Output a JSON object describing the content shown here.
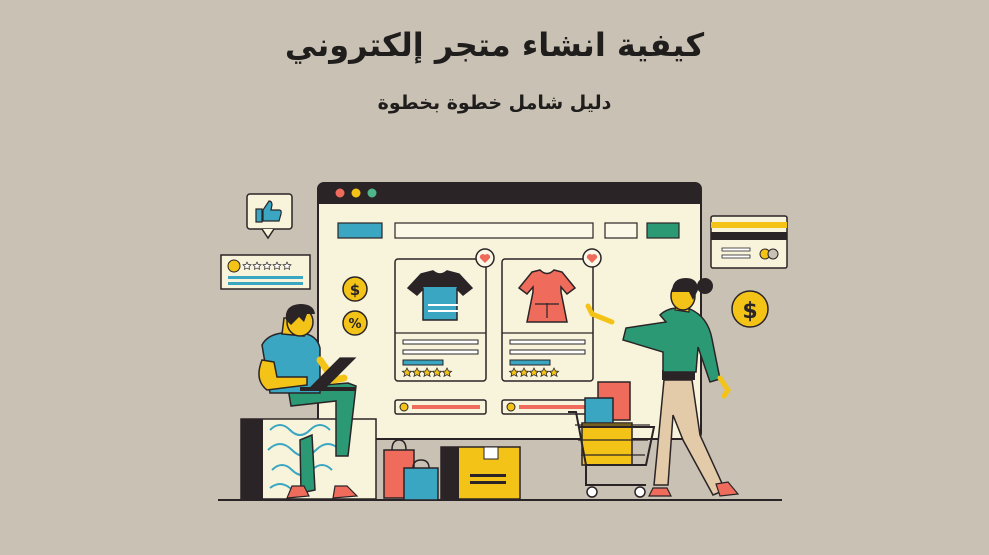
{
  "heading": {
    "title": "كيفية انشاء متجر إلكتروني",
    "subtitle": "دليل شامل خطوة بخطوة"
  },
  "illustration": {
    "icons": [
      "thumbs-up-icon",
      "star-icon",
      "dollar-icon",
      "percent-icon",
      "heart-icon",
      "credit-card-icon",
      "shopping-cart-icon",
      "shopping-bag-icon",
      "box-icon",
      "laptop-icon"
    ],
    "product_ratings": [
      5,
      5
    ],
    "review_rating": 5,
    "badges": {
      "dollar": "$",
      "percent": "%"
    }
  },
  "colors": {
    "background": "#c9c1b4",
    "window_frame": "#2a2426",
    "window_body": "#f8f4dc",
    "teal": "#3aa6c1",
    "green": "#2b9a74",
    "yellow": "#f3c318",
    "coral": "#ef6b5b",
    "dark": "#1f1e1d"
  }
}
